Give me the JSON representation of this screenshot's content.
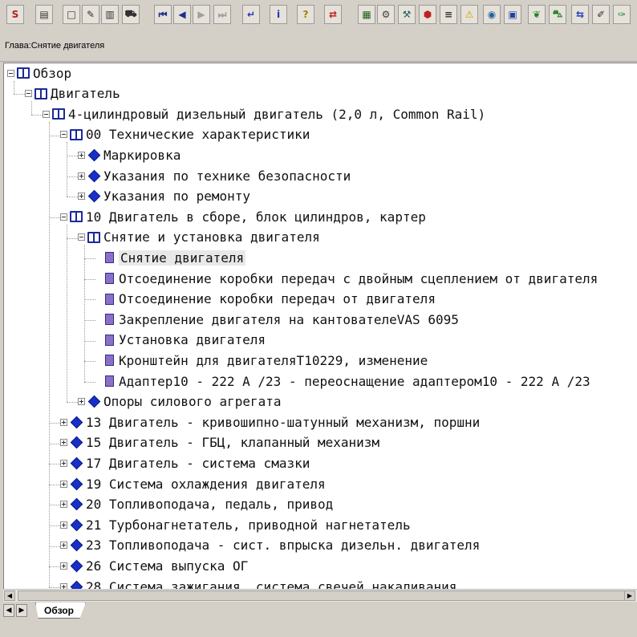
{
  "breadcrumb": "Глава:Снятие двигателя",
  "toolbar": {
    "buttons": [
      {
        "name": "save-icon",
        "glyph": "S",
        "color": "#b02020"
      },
      {
        "name": "print-icon",
        "glyph": "▤",
        "color": "#303030"
      },
      {
        "name": "new-doc-icon",
        "glyph": "□",
        "color": "#303030"
      },
      {
        "name": "edit-icon",
        "glyph": "✎",
        "color": "#303030"
      },
      {
        "name": "clipboard-icon",
        "glyph": "▥",
        "color": "#303030"
      },
      {
        "name": "car-icon",
        "glyph": "⛟",
        "color": "#303030"
      },
      {
        "name": "first-icon",
        "glyph": "⏮",
        "color": "#203090"
      },
      {
        "name": "prev-icon",
        "glyph": "◀",
        "color": "#203090"
      },
      {
        "name": "next-icon",
        "glyph": "▶",
        "color": "#a0a0a0"
      },
      {
        "name": "last-icon",
        "glyph": "⏭",
        "color": "#a0a0a0"
      },
      {
        "name": "return-icon",
        "glyph": "↵",
        "color": "#2030c0"
      },
      {
        "name": "info-icon",
        "glyph": "i",
        "color": "#2030c0"
      },
      {
        "name": "help-icon",
        "glyph": "?",
        "color": "#a08000"
      },
      {
        "name": "swap-icon",
        "glyph": "⇄",
        "color": "#c02020"
      },
      {
        "name": "calculator-icon",
        "glyph": "▦",
        "color": "#206020"
      },
      {
        "name": "engine-icon",
        "glyph": "⚙",
        "color": "#404040"
      },
      {
        "name": "tools-icon",
        "glyph": "⚒",
        "color": "#206060"
      },
      {
        "name": "stop-icon",
        "glyph": "⬢",
        "color": "#c02020"
      },
      {
        "name": "list-icon",
        "glyph": "≡",
        "color": "#303030"
      },
      {
        "name": "warning-icon",
        "glyph": "⚠",
        "color": "#c8a000"
      },
      {
        "name": "globe-icon",
        "glyph": "◉",
        "color": "#2060a0"
      },
      {
        "name": "display-icon",
        "glyph": "▣",
        "color": "#2040a0"
      },
      {
        "name": "leaf-icon",
        "glyph": "❦",
        "color": "#208020"
      },
      {
        "name": "car-side-icon",
        "glyph": "⛍",
        "color": "#208020"
      },
      {
        "name": "transfer-icon",
        "glyph": "⇆",
        "color": "#2040c0"
      },
      {
        "name": "page-edit-icon",
        "glyph": "✐",
        "color": "#303030"
      },
      {
        "name": "green-tool-icon",
        "glyph": "✑",
        "color": "#208040"
      }
    ]
  },
  "tree": [
    {
      "depth": 0,
      "type": "book",
      "exp": "minus",
      "label": "Обзор"
    },
    {
      "depth": 1,
      "type": "book",
      "exp": "minus",
      "label": "Двигатель"
    },
    {
      "depth": 2,
      "type": "book",
      "exp": "minus",
      "label": "4-цилиндровый дизельный двигатель (2,0 л, Common Rail)"
    },
    {
      "depth": 3,
      "type": "book",
      "exp": "minus",
      "label": "00 Технические характеристики"
    },
    {
      "depth": 4,
      "type": "diamond",
      "exp": "plus",
      "label": "Маркировка"
    },
    {
      "depth": 4,
      "type": "diamond",
      "exp": "plus",
      "label": "Указания по технике безопасности"
    },
    {
      "depth": 4,
      "type": "diamond",
      "exp": "plus",
      "label": "Указания по ремонту"
    },
    {
      "depth": 3,
      "type": "book",
      "exp": "minus",
      "label": "10 Двигатель в сборе, блок цилиндров, картер"
    },
    {
      "depth": 4,
      "type": "book",
      "exp": "minus",
      "label": "Снятие и установка двигателя"
    },
    {
      "depth": 5,
      "type": "page",
      "exp": "none",
      "label": "Снятие двигателя",
      "selected": true
    },
    {
      "depth": 5,
      "type": "page",
      "exp": "none",
      "label": "Отсоединение коробки передач с двойным сцеплением от двигателя"
    },
    {
      "depth": 5,
      "type": "page",
      "exp": "none",
      "label": "Отсоединение коробки передач от двигателя"
    },
    {
      "depth": 5,
      "type": "page",
      "exp": "none",
      "label": "Закрепление двигателя на кантователеVAS 6095"
    },
    {
      "depth": 5,
      "type": "page",
      "exp": "none",
      "label": "Установка двигателя"
    },
    {
      "depth": 5,
      "type": "page",
      "exp": "none",
      "label": "Кронштейн для двигателяT10229, изменение"
    },
    {
      "depth": 5,
      "type": "page",
      "exp": "none",
      "label": "Адаптер10 - 222 А /23 - переоснащение адаптером10 - 222 А /23"
    },
    {
      "depth": 4,
      "type": "diamond",
      "exp": "plus",
      "label": "Опоры силового агрегата"
    },
    {
      "depth": 3,
      "type": "diamond",
      "exp": "plus",
      "label": "13 Двигатель - кривошипно-шатунный механизм, поршни"
    },
    {
      "depth": 3,
      "type": "diamond",
      "exp": "plus",
      "label": "15 Двигатель - ГБЦ, клапанный механизм"
    },
    {
      "depth": 3,
      "type": "diamond",
      "exp": "plus",
      "label": "17 Двигатель - система смазки"
    },
    {
      "depth": 3,
      "type": "diamond",
      "exp": "plus",
      "label": "19 Система охлаждения двигателя"
    },
    {
      "depth": 3,
      "type": "diamond",
      "exp": "plus",
      "label": "20 Топливоподача, педаль, привод"
    },
    {
      "depth": 3,
      "type": "diamond",
      "exp": "plus",
      "label": "21 Турбонагнетатель, приводной нагнетатель"
    },
    {
      "depth": 3,
      "type": "diamond",
      "exp": "plus",
      "label": "23 Топливоподача - сист. впрыска дизельн. двигателя"
    },
    {
      "depth": 3,
      "type": "diamond",
      "exp": "plus",
      "label": "26 Система выпуска ОГ"
    },
    {
      "depth": 3,
      "type": "diamond",
      "exp": "plus",
      "label": "28 Система зажигания, система свечей накаливания"
    }
  ],
  "tabs": [
    {
      "label": "Обзор",
      "active": true
    }
  ],
  "tab_nav": [
    "◀",
    "▶"
  ]
}
